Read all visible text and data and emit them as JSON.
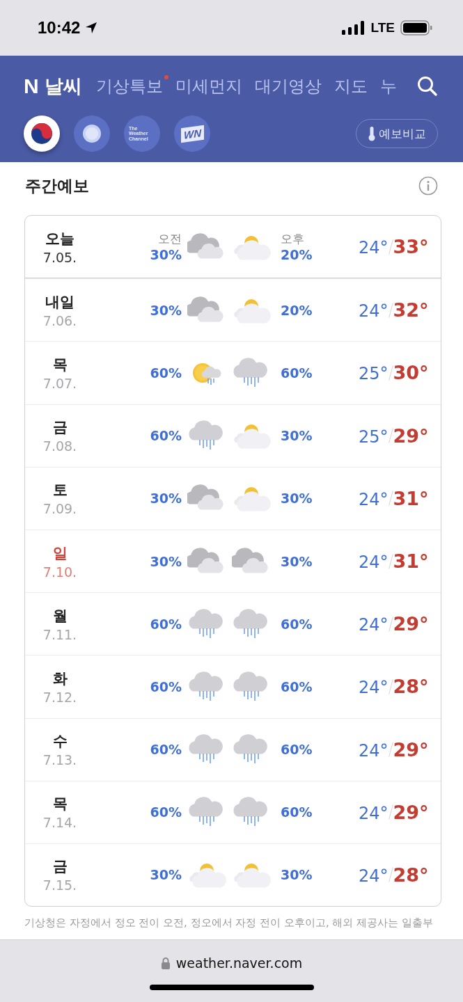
{
  "status_bar": {
    "time": "10:42",
    "network": "LTE"
  },
  "header": {
    "logo_mark": "N",
    "title": "날씨",
    "nav": [
      {
        "label": "기상특보",
        "dot": true
      },
      {
        "label": "미세먼지",
        "dot": false
      },
      {
        "label": "대기영상",
        "dot": false
      },
      {
        "label": "지도",
        "dot": false
      },
      {
        "label": "누",
        "dot": false
      }
    ],
    "providers": [
      {
        "kind": "kma",
        "selected": true
      },
      {
        "kind": "sun",
        "selected": false
      },
      {
        "kind": "twc",
        "label": "The Weather Channel",
        "selected": false
      },
      {
        "kind": "wni",
        "label": "WN",
        "selected": false
      }
    ],
    "compare_button": "예보비교"
  },
  "section": {
    "title": "주간예보"
  },
  "forecast": [
    {
      "day": "오늘",
      "date": "7.05.",
      "today": true,
      "holiday": false,
      "am_label": "오전",
      "pm_label": "오후",
      "am_pct": "30%",
      "am_icon": {
        "kind": "cloudy"
      },
      "pm_icon": {
        "kind": "partly"
      },
      "pm_pct": "20%",
      "low": "24°",
      "high": "33°"
    },
    {
      "day": "내일",
      "date": "7.06.",
      "today": false,
      "holiday": false,
      "am_pct": "30%",
      "am_icon": {
        "kind": "cloudy"
      },
      "pm_icon": {
        "kind": "partly"
      },
      "pm_pct": "20%",
      "low": "24°",
      "high": "32°"
    },
    {
      "day": "목",
      "date": "7.07.",
      "today": false,
      "holiday": false,
      "am_pct": "60%",
      "am_icon": {
        "kind": "sunrain"
      },
      "pm_icon": {
        "kind": "rain"
      },
      "pm_pct": "60%",
      "low": "25°",
      "high": "30°"
    },
    {
      "day": "금",
      "date": "7.08.",
      "today": false,
      "holiday": false,
      "am_pct": "60%",
      "am_icon": {
        "kind": "rain"
      },
      "pm_icon": {
        "kind": "partly"
      },
      "pm_pct": "30%",
      "low": "25°",
      "high": "29°"
    },
    {
      "day": "토",
      "date": "7.09.",
      "today": false,
      "holiday": false,
      "am_pct": "30%",
      "am_icon": {
        "kind": "cloudy"
      },
      "pm_icon": {
        "kind": "partly"
      },
      "pm_pct": "30%",
      "low": "24°",
      "high": "31°"
    },
    {
      "day": "일",
      "date": "7.10.",
      "today": false,
      "holiday": true,
      "am_pct": "30%",
      "am_icon": {
        "kind": "cloudy"
      },
      "pm_icon": {
        "kind": "cloudy"
      },
      "pm_pct": "30%",
      "low": "24°",
      "high": "31°"
    },
    {
      "day": "월",
      "date": "7.11.",
      "today": false,
      "holiday": false,
      "am_pct": "60%",
      "am_icon": {
        "kind": "rain"
      },
      "pm_icon": {
        "kind": "rain"
      },
      "pm_pct": "60%",
      "low": "24°",
      "high": "29°"
    },
    {
      "day": "화",
      "date": "7.12.",
      "today": false,
      "holiday": false,
      "am_pct": "60%",
      "am_icon": {
        "kind": "rain"
      },
      "pm_icon": {
        "kind": "rain"
      },
      "pm_pct": "60%",
      "low": "24°",
      "high": "28°"
    },
    {
      "day": "수",
      "date": "7.13.",
      "today": false,
      "holiday": false,
      "am_pct": "60%",
      "am_icon": {
        "kind": "rain"
      },
      "pm_icon": {
        "kind": "rain"
      },
      "pm_pct": "60%",
      "low": "24°",
      "high": "29°"
    },
    {
      "day": "목",
      "date": "7.14.",
      "today": false,
      "holiday": false,
      "am_pct": "60%",
      "am_icon": {
        "kind": "rain"
      },
      "pm_icon": {
        "kind": "rain"
      },
      "pm_pct": "60%",
      "low": "24°",
      "high": "29°"
    },
    {
      "day": "금",
      "date": "7.15.",
      "today": false,
      "holiday": false,
      "am_pct": "30%",
      "am_icon": {
        "kind": "partly"
      },
      "pm_icon": {
        "kind": "partly"
      },
      "pm_pct": "30%",
      "low": "24°",
      "high": "28°"
    }
  ],
  "note": "기상청은 자정에서 정오 전이 오전, 정오에서 자정 전이 오후이고, 해외 제공사는 일출부",
  "browser": {
    "url": "weather.naver.com"
  }
}
